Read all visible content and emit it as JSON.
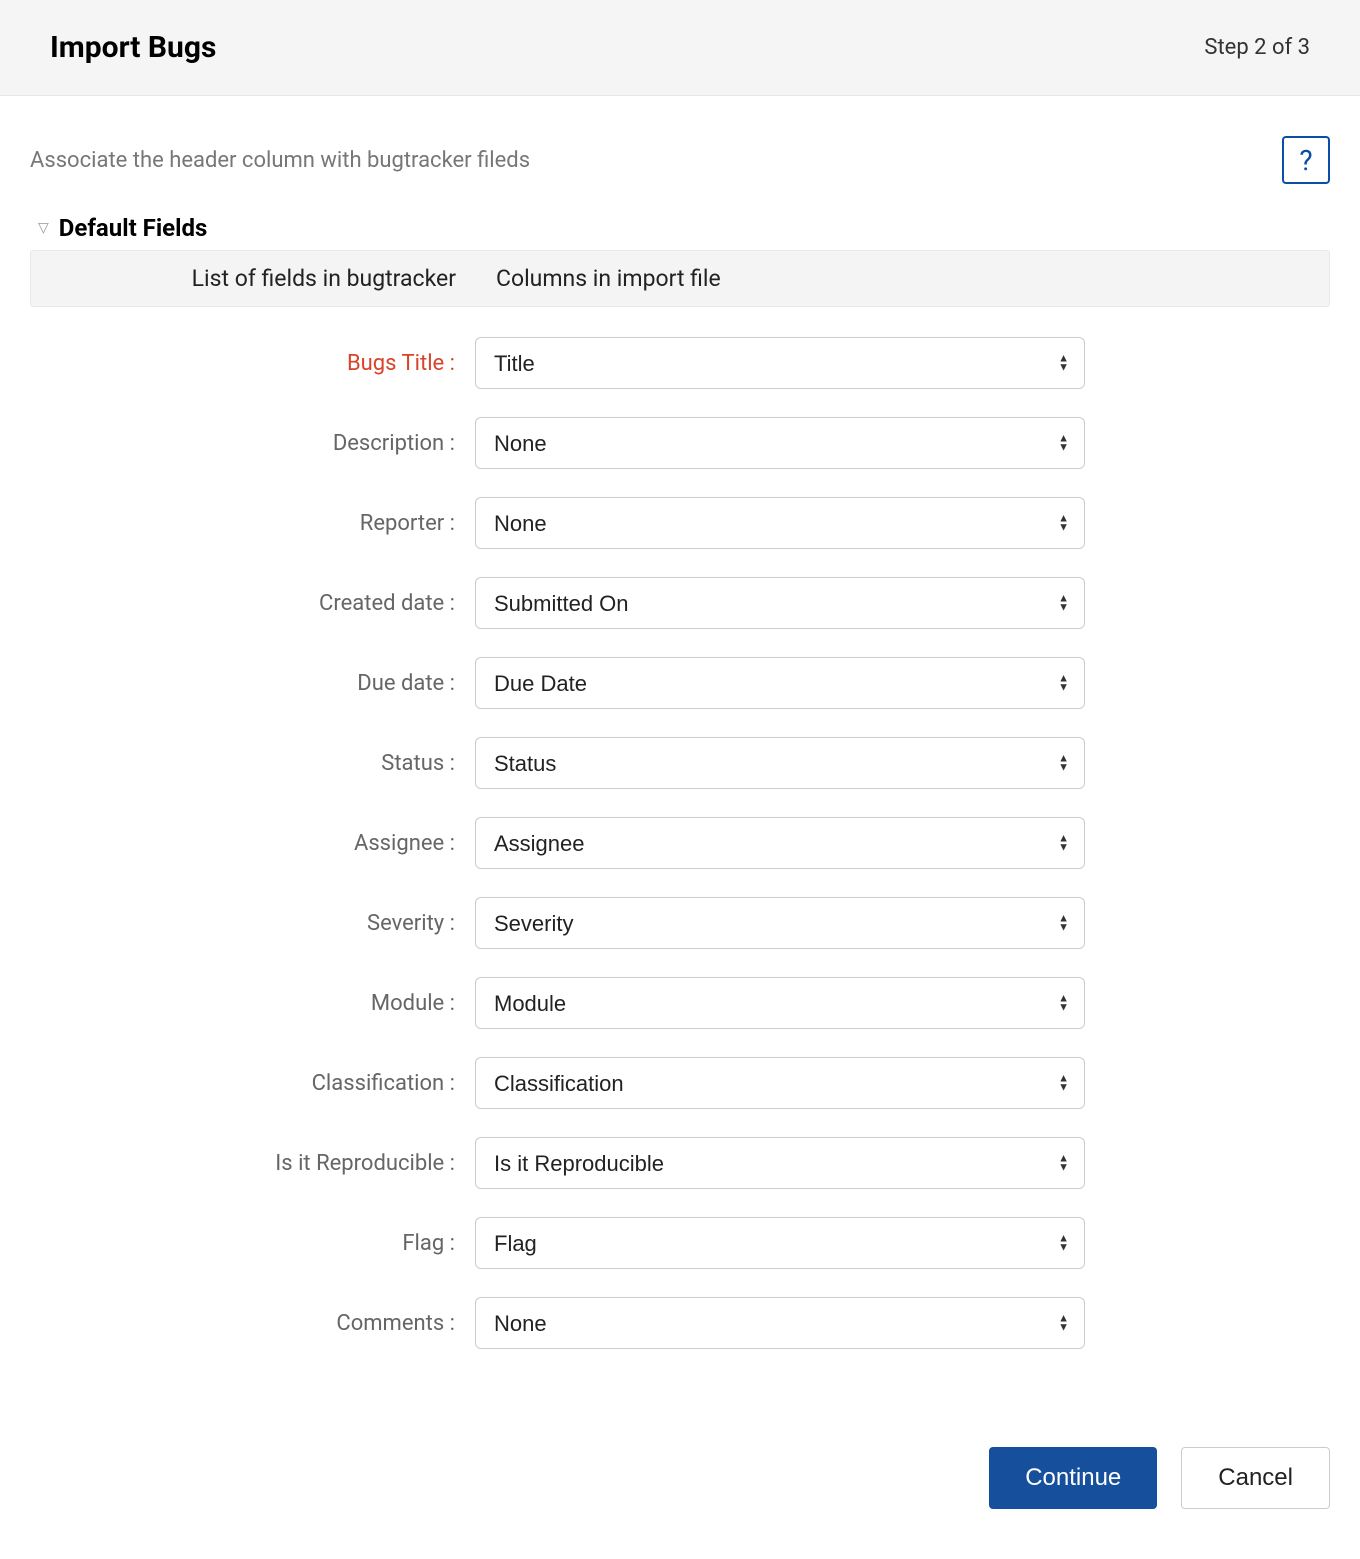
{
  "header": {
    "title": "Import Bugs",
    "step": "Step 2 of 3"
  },
  "instruction": "Associate the header column with bugtracker fileds",
  "help_icon": "?",
  "section": {
    "title": "Default Fields",
    "table_headers": {
      "left": "List of fields in bugtracker",
      "right": "Columns in import file"
    }
  },
  "fields": [
    {
      "label": "Bugs Title :",
      "value": "Title",
      "required": true
    },
    {
      "label": "Description :",
      "value": "None",
      "required": false
    },
    {
      "label": "Reporter :",
      "value": "None",
      "required": false
    },
    {
      "label": "Created date :",
      "value": "Submitted On",
      "required": false
    },
    {
      "label": "Due date :",
      "value": "Due Date",
      "required": false
    },
    {
      "label": "Status :",
      "value": "Status",
      "required": false
    },
    {
      "label": "Assignee :",
      "value": "Assignee",
      "required": false
    },
    {
      "label": "Severity :",
      "value": "Severity",
      "required": false
    },
    {
      "label": "Module :",
      "value": "Module",
      "required": false
    },
    {
      "label": "Classification :",
      "value": "Classification",
      "required": false
    },
    {
      "label": "Is it Reproducible :",
      "value": "Is it Reproducible",
      "required": false
    },
    {
      "label": "Flag :",
      "value": "Flag",
      "required": false
    },
    {
      "label": "Comments :",
      "value": "None",
      "required": false
    }
  ],
  "buttons": {
    "continue": "Continue",
    "cancel": "Cancel"
  }
}
